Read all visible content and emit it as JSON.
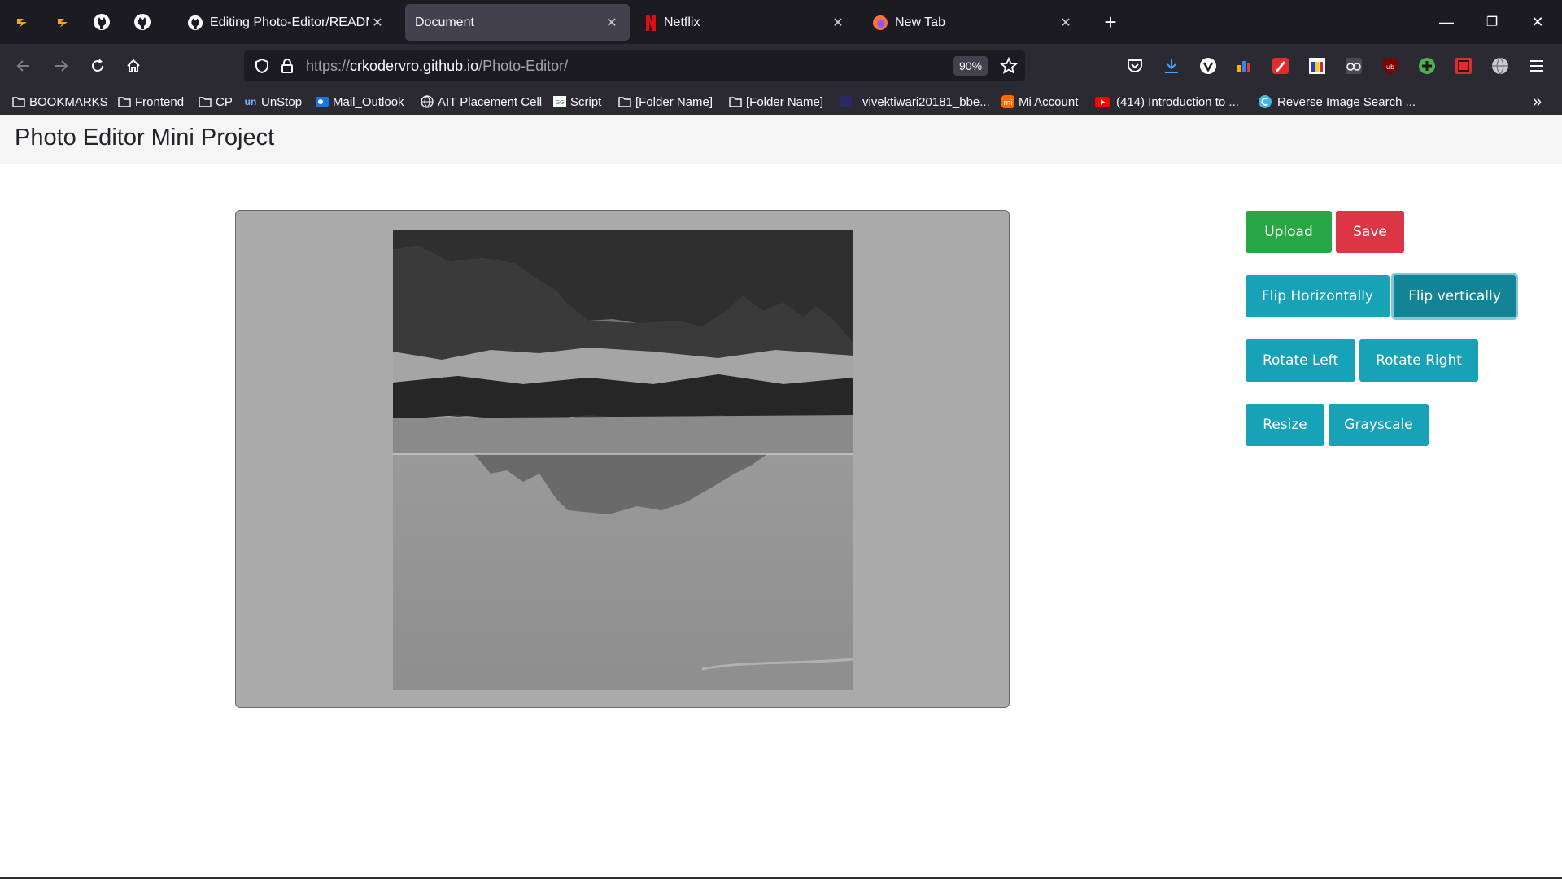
{
  "browser": {
    "tabs": [
      {
        "title": "Editing Photo-Editor/README.md",
        "icon": "github-icon",
        "active": false
      },
      {
        "title": "Document",
        "icon": "",
        "active": true
      },
      {
        "title": "Netflix",
        "icon": "netflix-icon",
        "active": false
      },
      {
        "title": "New Tab",
        "icon": "firefox-icon",
        "active": false
      }
    ],
    "url": {
      "scheme": "https://",
      "host": "crkodervro.github.io",
      "path": "/Photo-Editor/"
    },
    "zoom": "90%",
    "bookmarks": [
      {
        "label": "BOOKMARKS",
        "icon": "folder-icon"
      },
      {
        "label": "Frontend",
        "icon": "folder-icon"
      },
      {
        "label": "CP",
        "icon": "folder-icon"
      },
      {
        "label": "UnStop",
        "icon": "unstop-icon"
      },
      {
        "label": "Mail_Outlook",
        "icon": "outlook-icon"
      },
      {
        "label": "AIT Placement Cell",
        "icon": "globe-icon"
      },
      {
        "label": "Script",
        "icon": "script-icon"
      },
      {
        "label": "[Folder Name]",
        "icon": "folder-icon"
      },
      {
        "label": "[Folder Name]",
        "icon": "folder-icon"
      },
      {
        "label": "vivektiwari20181_bbe...",
        "icon": "page-icon"
      },
      {
        "label": "Mi Account",
        "icon": "mi-icon"
      },
      {
        "label": "(414) Introduction to ...",
        "icon": "youtube-icon"
      },
      {
        "label": "Reverse Image Search ...",
        "icon": "reverse-search-icon"
      }
    ]
  },
  "page": {
    "title": "Photo Editor Mini Project",
    "buttons": {
      "upload": "Upload",
      "save": "Save",
      "flip_horizontally": "Flip Horizontally",
      "flip_vertically": "Flip vertically",
      "rotate_left": "Rotate Left",
      "rotate_right": "Rotate Right",
      "resize": "Resize",
      "grayscale": "Grayscale"
    }
  },
  "colors": {
    "upload": "#28a745",
    "save": "#dc3545",
    "action": "#17a2b8",
    "action_focused": "#138496",
    "canvas_bg": "#aaaaaa",
    "header_bg": "#f5f5f5"
  }
}
